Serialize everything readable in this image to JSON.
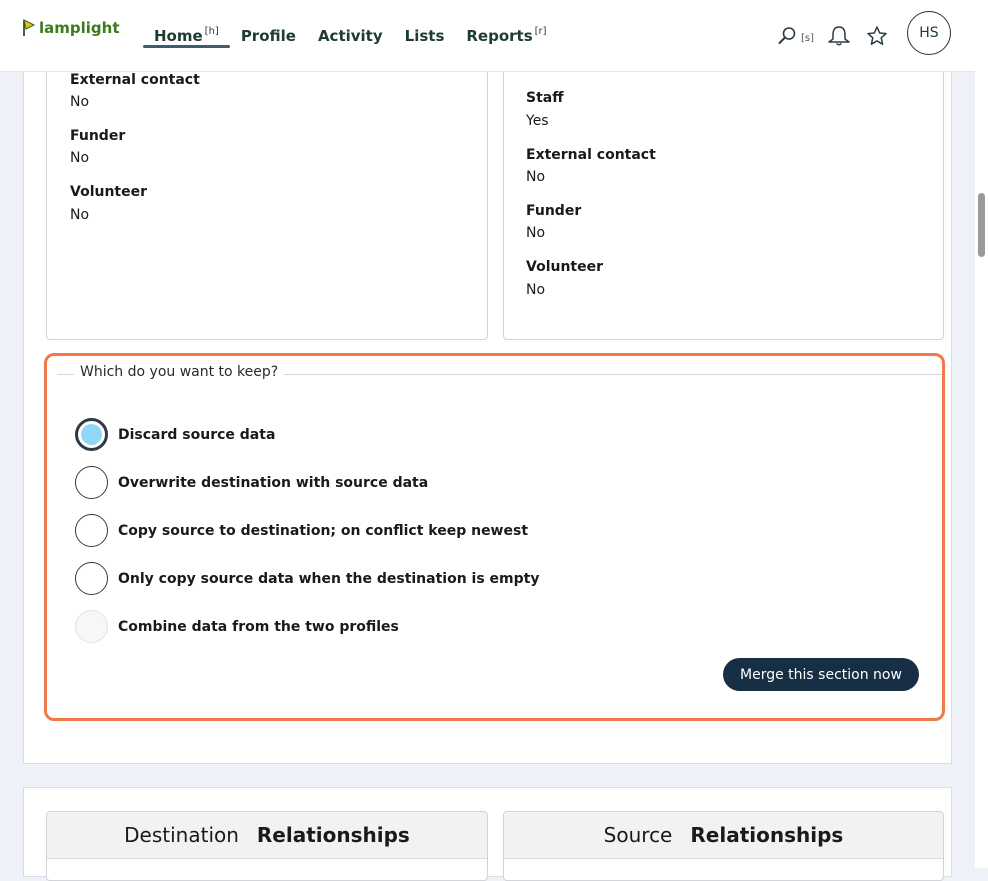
{
  "header": {
    "logo_text": "lamplight",
    "nav": [
      {
        "label": "Home",
        "shortcut": "[h]",
        "active": true
      },
      {
        "label": "Profile",
        "shortcut": ""
      },
      {
        "label": "Activity",
        "shortcut": ""
      },
      {
        "label": "Lists",
        "shortcut": ""
      },
      {
        "label": "Reports",
        "shortcut": "[r]"
      }
    ],
    "search_hint": "[s]",
    "avatar_initials": "HS",
    "icons": [
      "search-icon",
      "bell-icon",
      "star-icon"
    ]
  },
  "left_card": {
    "fields": [
      {
        "label": "External contact",
        "value": "No"
      },
      {
        "label": "Funder",
        "value": "No"
      },
      {
        "label": "Volunteer",
        "value": "No"
      }
    ]
  },
  "right_card": {
    "fields": [
      {
        "label": "Staff",
        "value": "Yes"
      },
      {
        "label": "External contact",
        "value": "No"
      },
      {
        "label": "Funder",
        "value": "No"
      },
      {
        "label": "Volunteer",
        "value": "No"
      }
    ]
  },
  "keep": {
    "legend": "Which do you want to keep?",
    "options": [
      {
        "label": "Discard source data",
        "state": "checked"
      },
      {
        "label": "Overwrite destination with source data",
        "state": "unchecked"
      },
      {
        "label": "Copy source to destination; on conflict keep newest",
        "state": "unchecked"
      },
      {
        "label": "Only copy source data when the destination is empty",
        "state": "unchecked"
      },
      {
        "label": "Combine data from the two profiles",
        "state": "disabled"
      }
    ],
    "merge_button": "Merge this section now"
  },
  "relationships": {
    "destination": {
      "prefix": "Destination",
      "title": "Relationships"
    },
    "source": {
      "prefix": "Source",
      "title": "Relationships"
    }
  },
  "colors": {
    "accent_border": "#f07a48",
    "button_bg": "#162f45",
    "radio_checked_fill": "#8ed7f5",
    "logo_green": "#3b7a1d"
  }
}
